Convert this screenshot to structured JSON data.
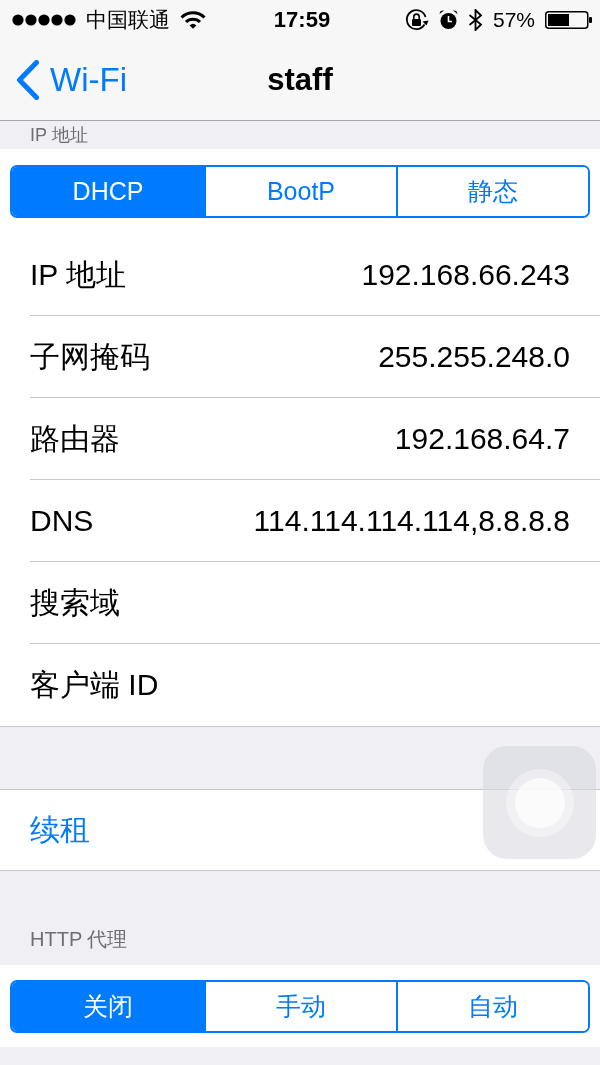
{
  "status_bar": {
    "carrier": "中国联通",
    "time": "17:59",
    "battery_percent": "57%"
  },
  "nav_bar": {
    "back_label": "Wi-Fi",
    "title": "staff"
  },
  "ip_section": {
    "header": "IP 地址",
    "modes": [
      {
        "label": "DHCP",
        "selected": true
      },
      {
        "label": "BootP",
        "selected": false
      },
      {
        "label": "静态",
        "selected": false
      }
    ]
  },
  "ip_fields": [
    {
      "label": "IP 地址",
      "value": "192.168.66.243"
    },
    {
      "label": "子网掩码",
      "value": "255.255.248.0"
    },
    {
      "label": "路由器",
      "value": "192.168.64.7"
    },
    {
      "label": "DNS",
      "value": "114.114.114.114,8.8.8.8"
    },
    {
      "label": "搜索域"
    },
    {
      "label": "客户端 ID"
    }
  ],
  "renew": {
    "label": "续租"
  },
  "http_proxy": {
    "header": "HTTP 代理",
    "modes": [
      {
        "label": "关闭",
        "selected": true
      },
      {
        "label": "手动",
        "selected": false
      },
      {
        "label": "自动",
        "selected": false
      }
    ]
  }
}
